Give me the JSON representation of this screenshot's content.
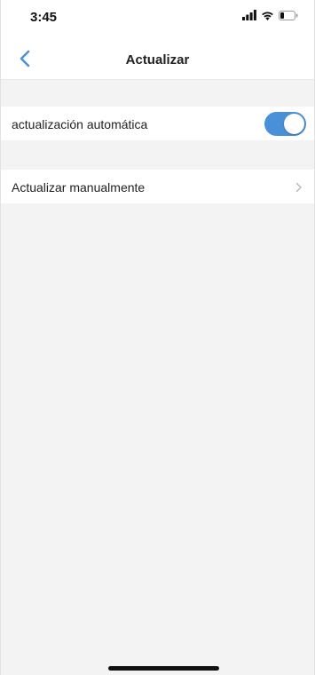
{
  "status_bar": {
    "time": "3:45",
    "icons": [
      "signal-icon",
      "wifi-icon",
      "battery-icon"
    ]
  },
  "nav": {
    "title": "Actualizar",
    "back_icon": "chevron-left-icon"
  },
  "settings": {
    "auto_update": {
      "label": "actualización automática",
      "enabled": true
    },
    "manual_update": {
      "label": "Actualizar manualmente",
      "icon": "chevron-right-icon"
    }
  },
  "colors": {
    "accent": "#4a90d9",
    "background": "#f3f3f3",
    "row_background": "#ffffff"
  }
}
